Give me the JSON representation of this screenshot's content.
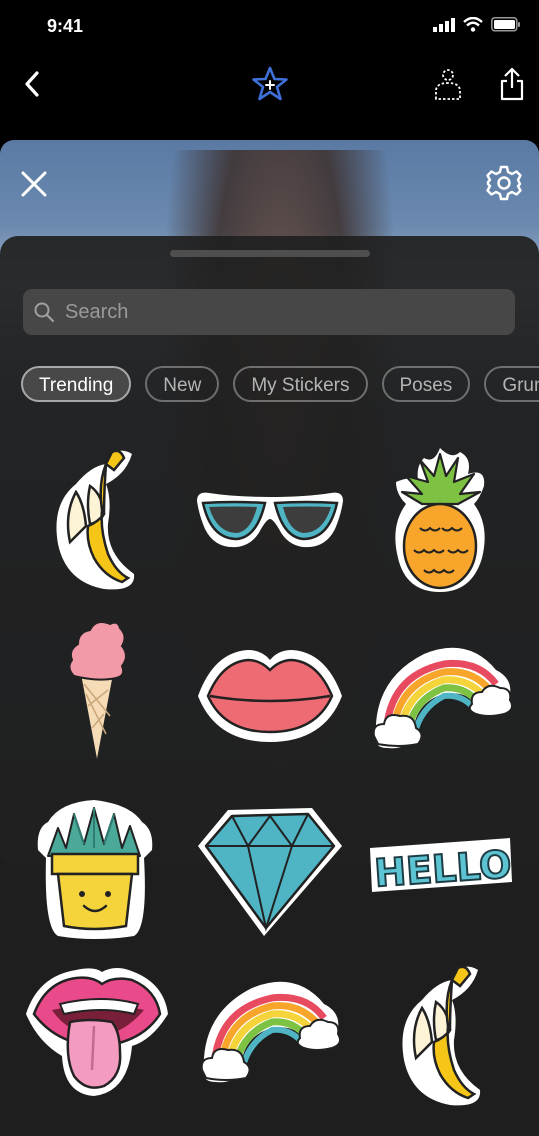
{
  "status": {
    "time": "9:41"
  },
  "nav": {
    "back_icon": "chevron-left-icon",
    "favorite_icon": "star-plus-icon",
    "select_person_icon": "person-select-icon",
    "share_icon": "share-icon"
  },
  "colors": {
    "accent": "#3f6fd8",
    "sheet": "#202020",
    "chip_border": "#6f6f6f",
    "search_bg": "#474747"
  },
  "search": {
    "placeholder": "Search"
  },
  "chips": [
    {
      "label": "Trending",
      "active": true
    },
    {
      "label": "New",
      "active": false
    },
    {
      "label": "My Stickers",
      "active": false
    },
    {
      "label": "Poses",
      "active": false
    },
    {
      "label": "Grunge",
      "active": false
    }
  ],
  "stickers": [
    {
      "name": "banana"
    },
    {
      "name": "sunglasses"
    },
    {
      "name": "pineapple"
    },
    {
      "name": "ice-cream"
    },
    {
      "name": "lips"
    },
    {
      "name": "rainbow"
    },
    {
      "name": "succulent-pot"
    },
    {
      "name": "diamond"
    },
    {
      "name": "hello",
      "text": "HELLO!"
    },
    {
      "name": "tongue-mouth"
    },
    {
      "name": "rainbow"
    },
    {
      "name": "banana"
    }
  ]
}
